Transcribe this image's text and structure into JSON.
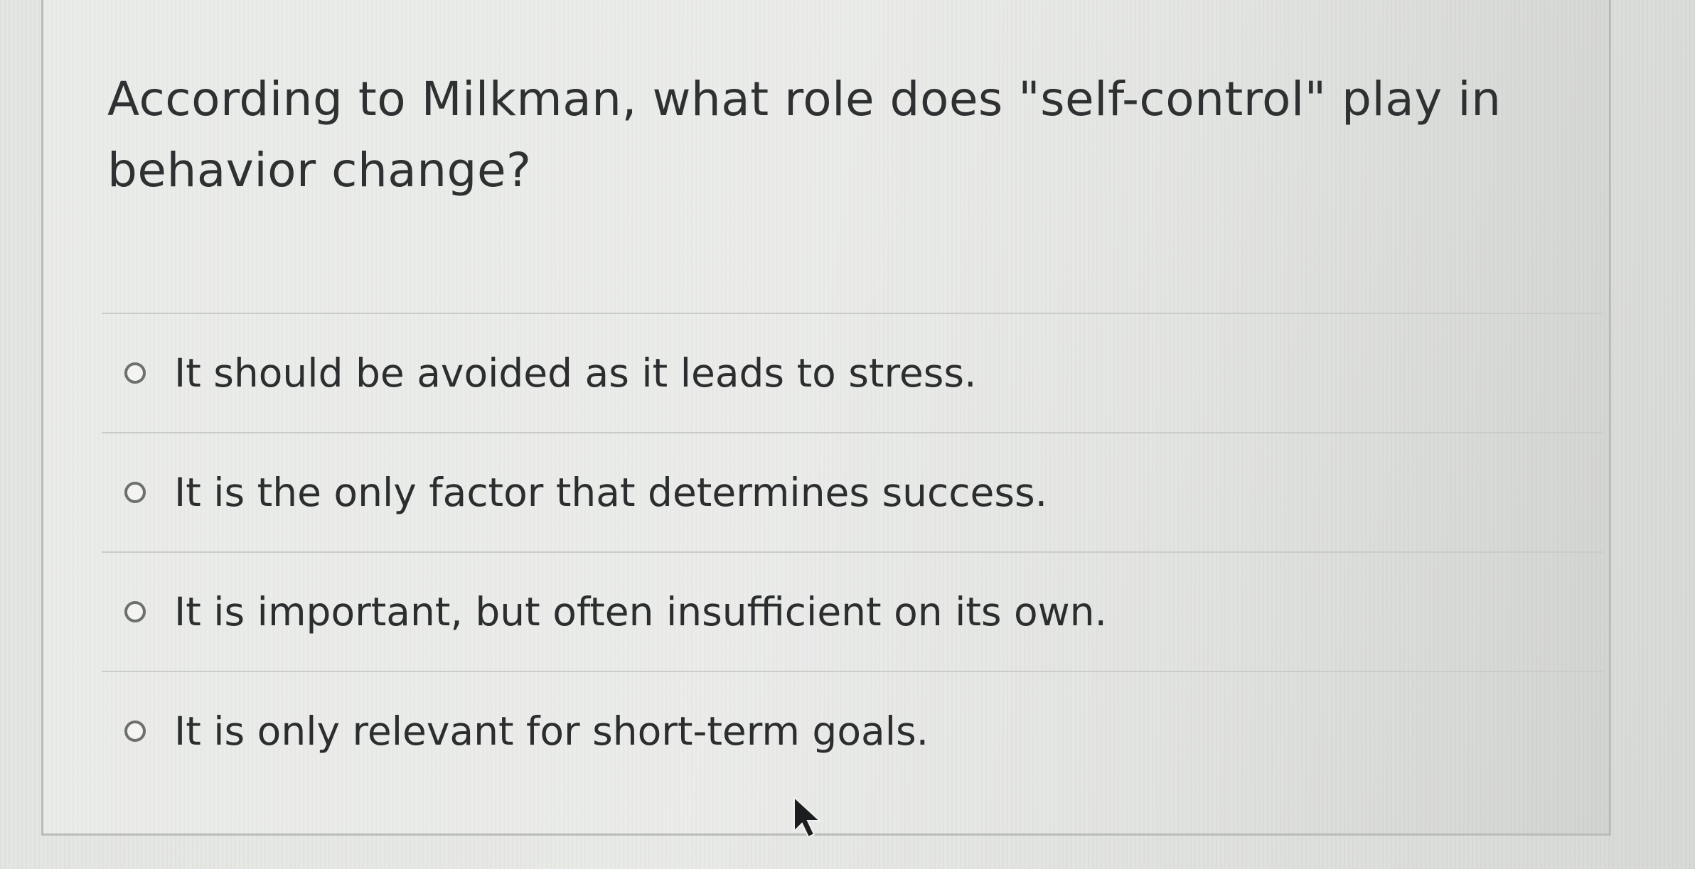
{
  "question": {
    "text": "According to Milkman, what role does \"self-control\" play in behavior change?"
  },
  "answers": [
    {
      "label": "It should be avoided as it leads to stress.",
      "selected": false
    },
    {
      "label": "It is the only factor that determines success.",
      "selected": false
    },
    {
      "label": "It is important, but often insufficient on its own.",
      "selected": false
    },
    {
      "label": "It is only relevant for short-term goals.",
      "selected": false
    }
  ],
  "icons": {
    "pointer": "mouse-pointer-icon",
    "radio": "radio-unchecked-icon"
  },
  "colors": {
    "text": "#2f3031",
    "background": "#e3e5e2",
    "border": "#b9bcb8"
  }
}
